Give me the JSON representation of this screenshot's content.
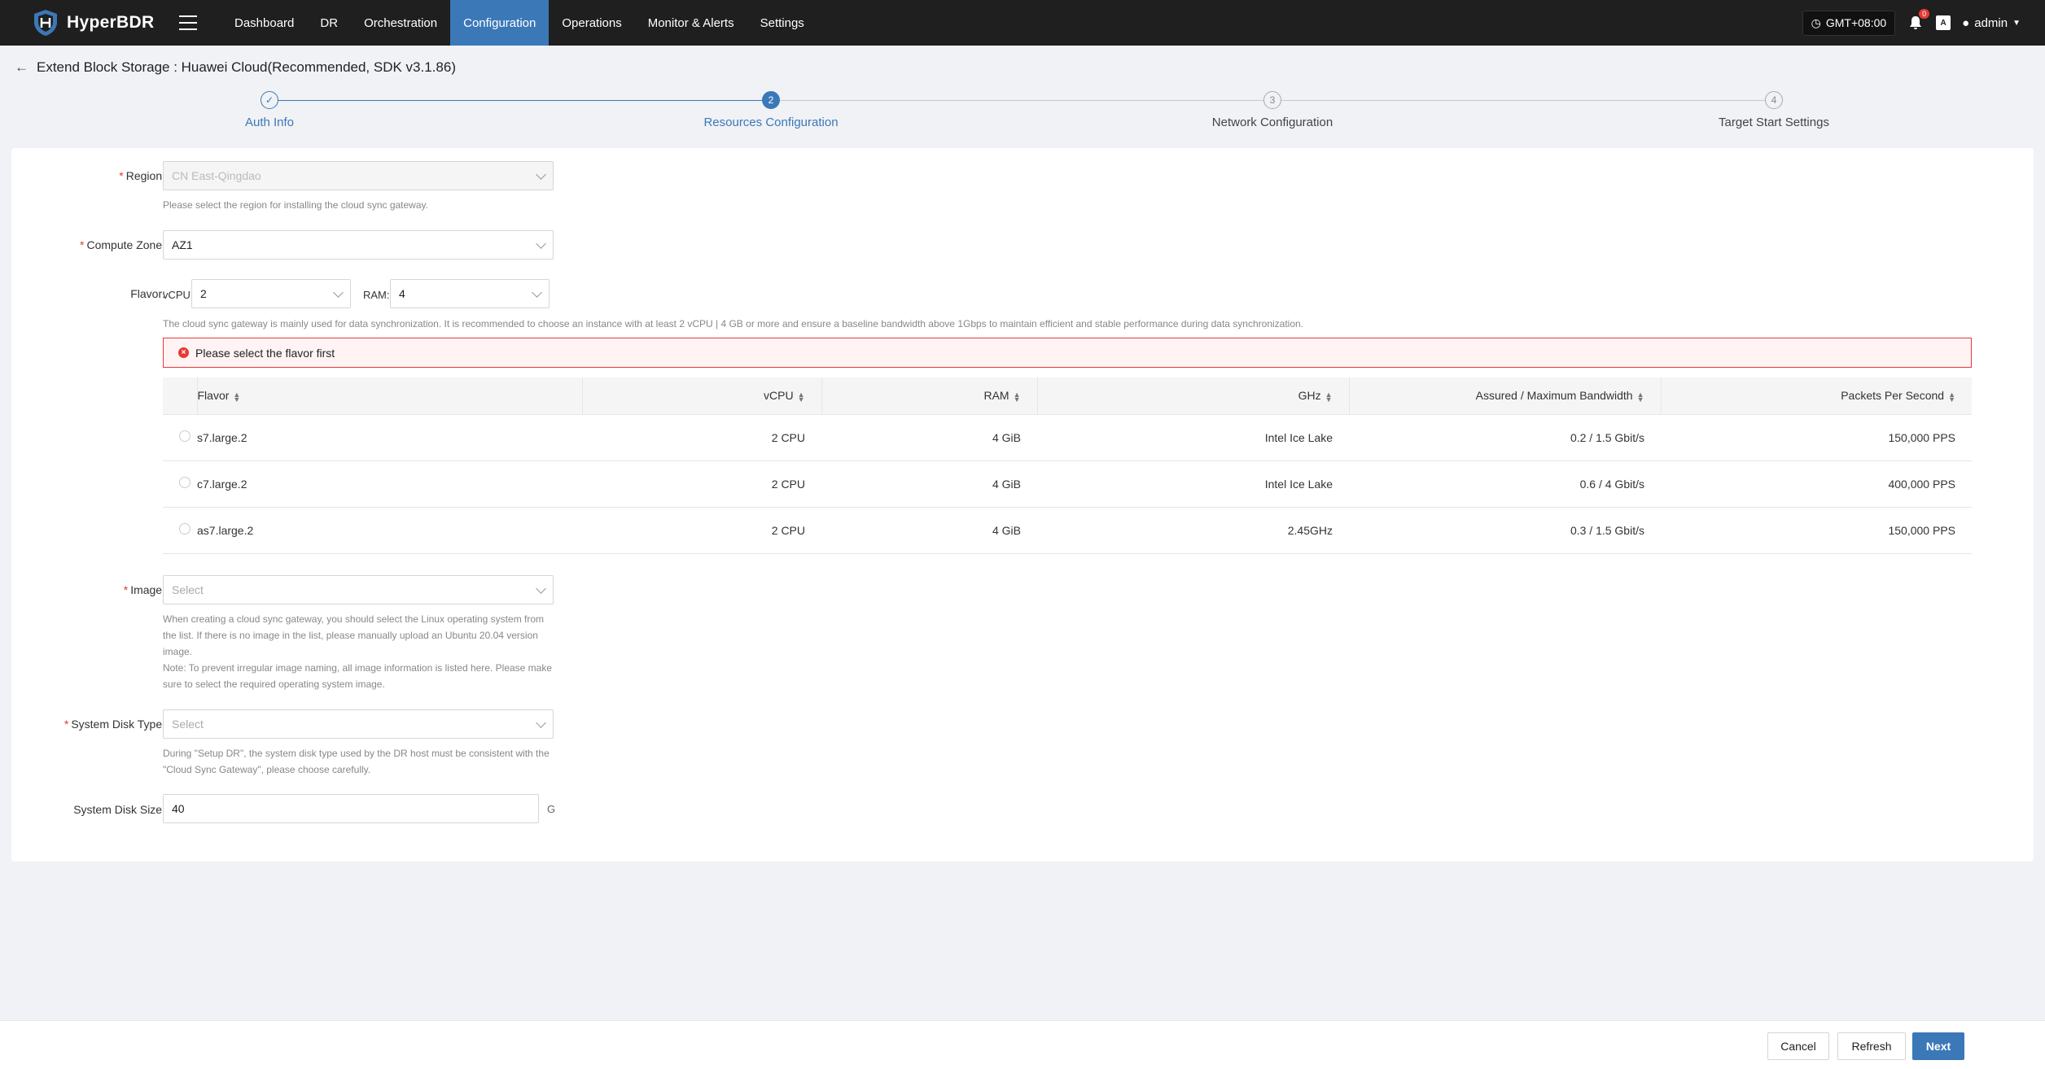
{
  "app": {
    "name": "HyperBDR"
  },
  "nav": {
    "items": [
      {
        "label": "Dashboard"
      },
      {
        "label": "DR"
      },
      {
        "label": "Orchestration"
      },
      {
        "label": "Configuration",
        "active": true
      },
      {
        "label": "Operations"
      },
      {
        "label": "Monitor & Alerts"
      },
      {
        "label": "Settings"
      }
    ],
    "timezone": "GMT+08:00",
    "notification_count": "0",
    "user": "admin"
  },
  "page": {
    "title": "Extend Block Storage : Huawei Cloud(Recommended, SDK v3.1.86)"
  },
  "steps": [
    {
      "number": "✓",
      "label": "Auth Info",
      "state": "done"
    },
    {
      "number": "2",
      "label": "Resources Configuration",
      "state": "active"
    },
    {
      "number": "3",
      "label": "Network Configuration",
      "state": "pending"
    },
    {
      "number": "4",
      "label": "Target Start Settings",
      "state": "pending"
    }
  ],
  "form": {
    "region": {
      "label": "Region:",
      "value": "CN East-Qingdao",
      "hint": "Please select the region for installing the cloud sync gateway."
    },
    "zone": {
      "label": "Compute Zone:",
      "value": "AZ1"
    },
    "flavor": {
      "label": "Flavor:",
      "vcpu_label": "vCPU:",
      "vcpu_value": "2",
      "ram_label": "RAM:",
      "ram_value": "4",
      "hint": "The cloud sync gateway is mainly used for data synchronization. It is recommended to choose an instance with at least 2 vCPU | 4 GB or more and ensure a baseline bandwidth above 1Gbps to maintain efficient and stable performance during data synchronization.",
      "error": "Please select the flavor first"
    },
    "table": {
      "headers": [
        "Flavor",
        "vCPU",
        "RAM",
        "GHz",
        "Assured / Maximum Bandwidth",
        "Packets Per Second"
      ],
      "rows": [
        [
          "s7.large.2",
          "2 CPU",
          "4 GiB",
          "Intel Ice Lake",
          "0.2 / 1.5 Gbit/s",
          "150,000 PPS"
        ],
        [
          "c7.large.2",
          "2 CPU",
          "4 GiB",
          "Intel Ice Lake",
          "0.6 / 4 Gbit/s",
          "400,000 PPS"
        ],
        [
          "as7.large.2",
          "2 CPU",
          "4 GiB",
          "2.45GHz",
          "0.3 / 1.5 Gbit/s",
          "150,000 PPS"
        ]
      ]
    },
    "image": {
      "label": "Image:",
      "placeholder": "Select",
      "hint1": "When creating a cloud sync gateway, you should select the Linux operating system from",
      "hint2": "the list. If there is no image in the list, please manually upload an Ubuntu 20.04 version",
      "hint3": "image.",
      "hint4": "Note: To prevent irregular image naming, all image information is listed here. Please make",
      "hint5": "sure to select the required operating system image."
    },
    "disk_type": {
      "label": "System Disk Type:",
      "placeholder": "Select",
      "hint1": "During \"Setup DR\", the system disk type used by the DR host must be consistent with the",
      "hint2": "\"Cloud Sync Gateway\", please choose carefully."
    },
    "disk_size": {
      "label": "System Disk Size:",
      "value": "40",
      "unit": "G"
    }
  },
  "footer": {
    "cancel": "Cancel",
    "refresh": "Refresh",
    "next": "Next"
  },
  "colors": {
    "accent": "#3b78b8",
    "topbar": "#1f1f1f",
    "error": "#e53935"
  }
}
